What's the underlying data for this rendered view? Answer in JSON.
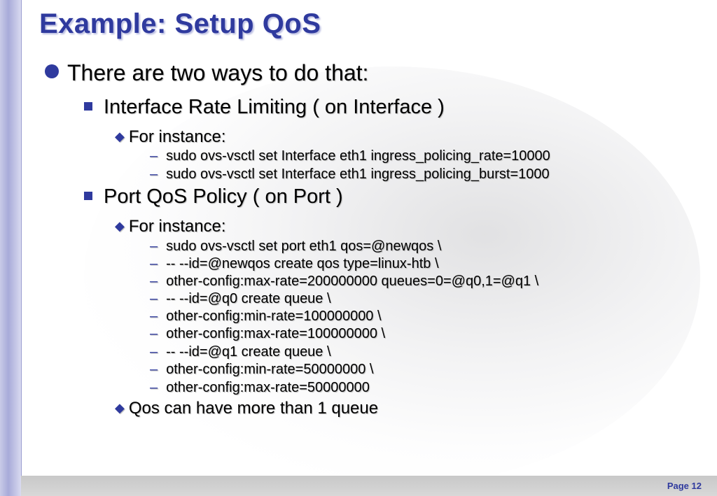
{
  "slide": {
    "title": "Example: Setup QoS",
    "page_label": "Page 12"
  },
  "bullets": {
    "intro": "There are two ways to do that:",
    "method1": "Interface Rate Limiting ( on Interface )",
    "method1_instance": "For instance:",
    "method1_cmds": [
      "sudo ovs-vsctl set Interface eth1 ingress_policing_rate=10000",
      "sudo ovs-vsctl set Interface eth1 ingress_policing_burst=1000"
    ],
    "method2": "Port  QoS Policy ( on Port )",
    "method2_instance": "For instance:",
    "method2_cmds": [
      "sudo ovs-vsctl set port eth1 qos=@newqos \\",
      "-- --id=@newqos create qos type=linux-htb \\",
      "other-config:max-rate=200000000 queues=0=@q0,1=@q1 \\",
      "-- --id=@q0 create queue \\",
      "other-config:min-rate=100000000 \\",
      "other-config:max-rate=100000000 \\",
      "-- --id=@q1 create queue \\",
      "other-config:min-rate=50000000 \\",
      "other-config:max-rate=50000000"
    ],
    "note": "Qos can have more than 1 queue"
  },
  "colors": {
    "accent": "#2f3a9e",
    "side_bar": "#a8abd9",
    "footer": "#cccccc"
  }
}
